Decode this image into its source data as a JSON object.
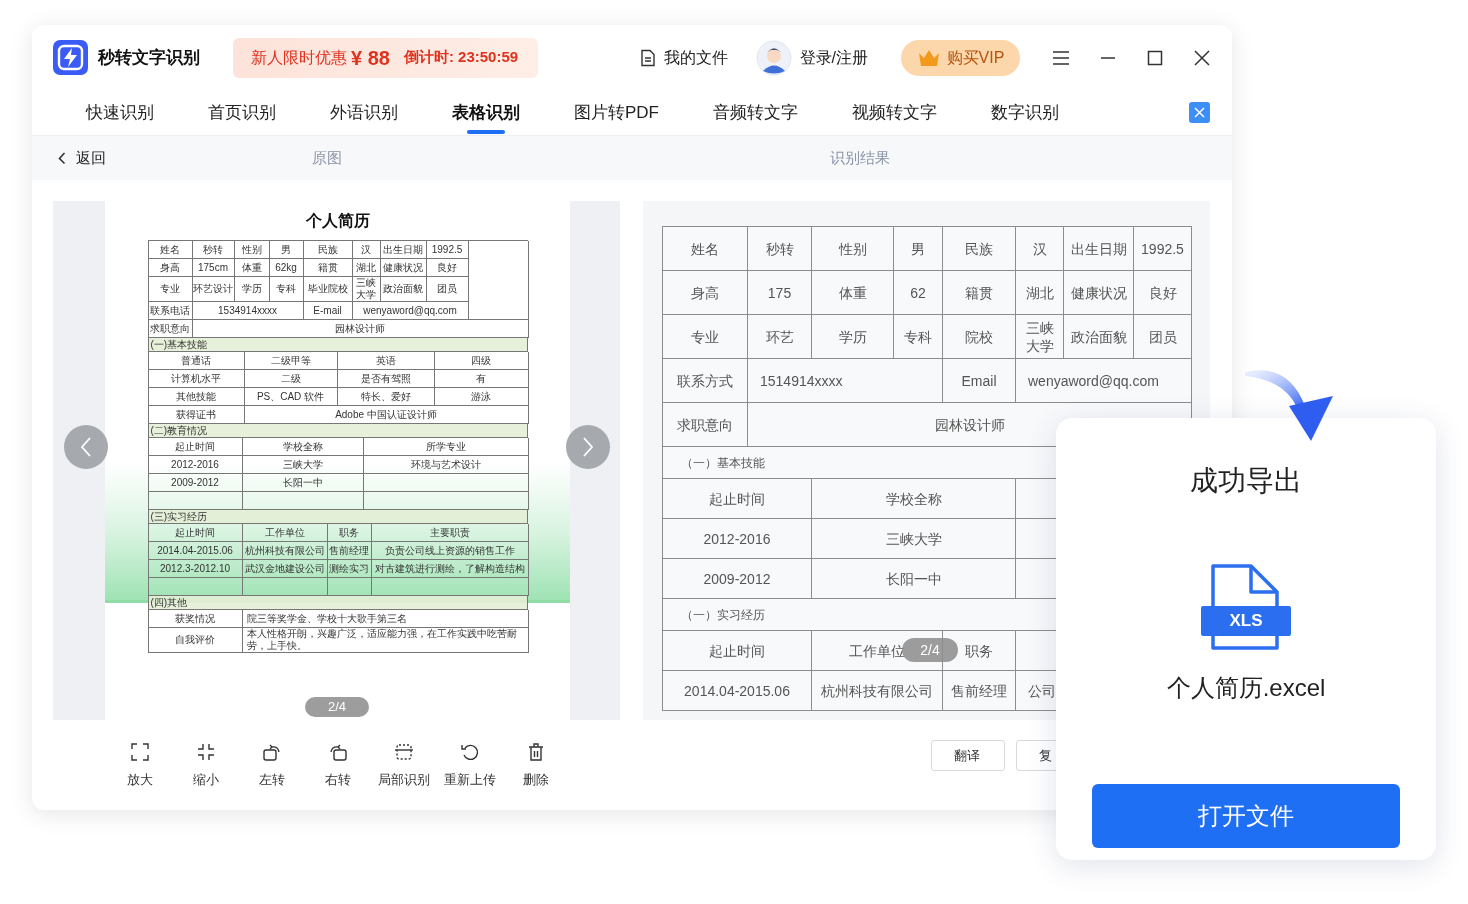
{
  "app": {
    "title": "秒转文字识别"
  },
  "promo": {
    "label": "新人限时优惠",
    "price": "¥ 88",
    "countdown": "倒计时: 23:50:59"
  },
  "header_links": [
    {
      "kind": "files",
      "label": "我的文件"
    },
    {
      "kind": "account",
      "label": "登录/注册"
    }
  ],
  "vip_button": {
    "label": "购买VIP"
  },
  "tabs": [
    {
      "label": "快速识别",
      "selected": false
    },
    {
      "label": "首页识别",
      "selected": false
    },
    {
      "label": "外语识别",
      "selected": false
    },
    {
      "label": "表格识别",
      "selected": true
    },
    {
      "label": "图片转PDF",
      "selected": false
    },
    {
      "label": "音频转文字",
      "selected": false
    },
    {
      "label": "视频转文字",
      "selected": false
    },
    {
      "label": "数字识别",
      "selected": false
    }
  ],
  "subbar": {
    "back": "返回",
    "original_label": "原图",
    "result_label": "识别结果"
  },
  "document": {
    "title": "个人简历",
    "page_indicator": "2/4",
    "blocks": [
      {
        "kind": "grid",
        "rows": [
          [
            "姓名",
            "秒转",
            "性别",
            "男",
            "民族",
            "汉",
            "出生日期",
            "1992.5",
            ""
          ],
          [
            "身高",
            "175cm",
            "体重",
            "62kg",
            "籍贯",
            "湖北",
            "健康状况",
            "良好",
            ""
          ],
          [
            "专业",
            "环艺设计",
            "学历",
            "专科",
            "毕业院校",
            "三峡大学",
            "政治面貌",
            "团员",
            ""
          ],
          [
            "联系电话",
            "1534914xxxx",
            "",
            "",
            "E-mail",
            "wenyaword@qq.com",
            "",
            "",
            ""
          ],
          [
            "求职意向",
            "",
            "",
            "",
            "",
            "园林设计师",
            "",
            "",
            ""
          ]
        ]
      },
      {
        "kind": "section",
        "text": "(一)基本技能"
      },
      {
        "kind": "grid",
        "rows": [
          [
            "普通话",
            "二级甲等",
            "英语",
            "四级"
          ],
          [
            "计算机水平",
            "二级",
            "是否有驾照",
            "有"
          ],
          [
            "其他技能",
            "PS、CAD 软件",
            "特长、爱好",
            "游泳"
          ],
          [
            "获得证书",
            "",
            "Adobe 中国认证设计师",
            ""
          ]
        ]
      },
      {
        "kind": "section",
        "text": "(二)教育情况"
      },
      {
        "kind": "grid",
        "rows": [
          [
            "起止时间",
            "学校全称",
            "所学专业"
          ],
          [
            "2012-2016",
            "三峡大学",
            "环境与艺术设计"
          ],
          [
            "2009-2012",
            "长阳一中",
            ""
          ],
          [
            "",
            "",
            ""
          ]
        ]
      },
      {
        "kind": "section",
        "text": "(三)实习经历"
      },
      {
        "kind": "grid",
        "rows": [
          [
            "起止时间",
            "工作单位",
            "职务",
            "主要职责"
          ],
          [
            "2014.04-2015.06",
            "杭州科技有限公司",
            "售前经理",
            "负责公司线上资源的销售工作"
          ],
          [
            "2012.3-2012.10",
            "武汉金地建设公司",
            "测绘实习",
            "对古建筑进行测绘，了解构造结构"
          ],
          [
            "",
            "",
            "",
            ""
          ]
        ]
      },
      {
        "kind": "section",
        "text": "(四)其他"
      },
      {
        "kind": "grid",
        "rows": [
          [
            "获奖情况",
            "院三等奖学金、学校十大歌手第三名"
          ],
          [
            "自我评价",
            "本人性格开朗，兴趣广泛，适应能力强，在工作实践中吃苦耐劳，上手快。"
          ]
        ]
      }
    ]
  },
  "toolbar": [
    {
      "kind": "zoom_in",
      "label": "放大"
    },
    {
      "kind": "zoom_out",
      "label": "缩小"
    },
    {
      "kind": "rotate_left",
      "label": "左转"
    },
    {
      "kind": "rotate_right",
      "label": "右转"
    },
    {
      "kind": "crop",
      "label": "局部识别"
    },
    {
      "kind": "reupload",
      "label": "重新上传"
    },
    {
      "kind": "delete",
      "label": "删除"
    }
  ],
  "result": {
    "page_indicator": "2/4",
    "buttons": [
      "翻译",
      "复"
    ],
    "blocks": [
      {
        "kind": "grid",
        "rows": [
          [
            "姓名",
            "秒转",
            "性别",
            "男",
            "民族",
            "汉",
            "出生日期",
            "1992.5"
          ],
          [
            "身高",
            "175",
            "体重",
            "62",
            "籍贯",
            "湖北",
            "健康状况",
            "良好"
          ],
          [
            "专业",
            "环艺",
            "学历",
            "专科",
            "院校",
            "三峡大学",
            "政治面貌",
            "团员"
          ],
          [
            "联系方式",
            "1514914xxxx",
            "",
            "",
            "Email",
            "wenyaword@qq.com",
            "",
            ""
          ],
          [
            "求职意向",
            "",
            "",
            "",
            "园林设计师",
            "",
            "",
            ""
          ]
        ]
      },
      {
        "kind": "section",
        "text": "（一）基本技能"
      },
      {
        "kind": "grid",
        "rows": [
          [
            "起止时间",
            "",
            "学校全称",
            "",
            "",
            "",
            "",
            ""
          ],
          [
            "2012-2016",
            "",
            "三峡大学",
            "",
            "",
            "",
            "",
            ""
          ],
          [
            "2009-2012",
            "",
            "长阳一中",
            "",
            "",
            "",
            "",
            ""
          ]
        ]
      },
      {
        "kind": "section",
        "text": "（一）实习经历"
      },
      {
        "kind": "grid",
        "rows": [
          [
            "起止时间",
            "",
            "工作单位",
            "",
            "职务",
            "",
            "",
            ""
          ],
          [
            "2014.04-2015.06",
            "",
            "杭州科技有限公司",
            "",
            "售前经理",
            "公司",
            "",
            ""
          ]
        ]
      }
    ]
  },
  "export_dialog": {
    "title": "成功导出",
    "file_type": "XLS",
    "file_name": "个人简历.excel",
    "button": "打开文件"
  }
}
